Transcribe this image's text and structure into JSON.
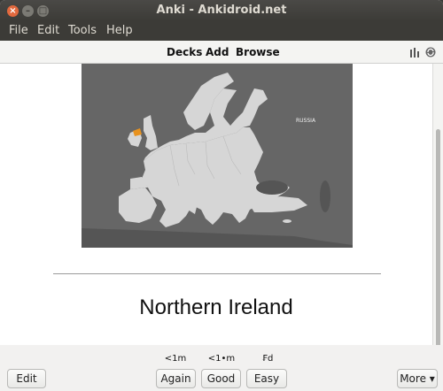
{
  "window": {
    "title": "Anki - Ankidroid.net"
  },
  "menu": {
    "file": "File",
    "edit": "Edit",
    "tools": "Tools",
    "help": "Help"
  },
  "toolbar": {
    "decks": "Decks",
    "add": "Add",
    "browse": "Browse"
  },
  "card": {
    "map_label": "RUSSIA",
    "highlight_color": "#e8921e",
    "answer": "Northern Ireland"
  },
  "bottom": {
    "edit": "Edit",
    "again_time": "<1m",
    "good_time": "<1•m",
    "easy_time": "₣d",
    "again": "Again",
    "good": "Good",
    "easy": "Easy",
    "more": "More ▾"
  }
}
